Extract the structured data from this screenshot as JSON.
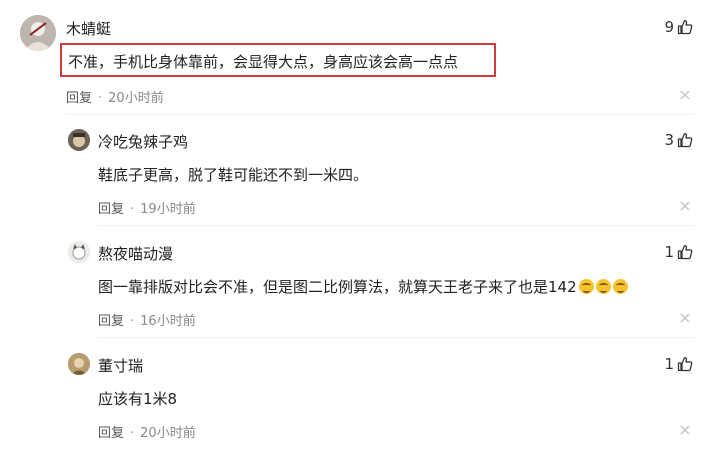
{
  "comments": [
    {
      "name": "木蜻蜓",
      "text": "不准，手机比身体靠前，会显得大点，身高应该会高一点点",
      "reply_label": "回复",
      "time": "20小时前",
      "likes": "9",
      "avatar_icon": "user-avatar"
    },
    {
      "name": "冷吃兔辣子鸡",
      "text": "鞋底子更高，脱了鞋可能还不到一米四。",
      "reply_label": "回复",
      "time": "19小时前",
      "likes": "3",
      "avatar_icon": "user-avatar"
    },
    {
      "name": "熬夜喵动漫",
      "text": "图一靠排版对比会不准，但是图二比例算法，就算天王老子来了也是142",
      "reply_label": "回复",
      "time": "16小时前",
      "likes": "1",
      "avatar_icon": "user-avatar"
    },
    {
      "name": "董寸瑞",
      "text": "应该有1米8",
      "reply_label": "回复",
      "time": "20小时前",
      "likes": "1",
      "avatar_icon": "user-avatar"
    }
  ],
  "icons": {
    "like": "thumbs-up-icon",
    "close": "close-icon",
    "emoji": "laughing-emoji"
  },
  "colors": {
    "highlight_border": "#d23b3b",
    "emoji": "#f6c22d"
  }
}
